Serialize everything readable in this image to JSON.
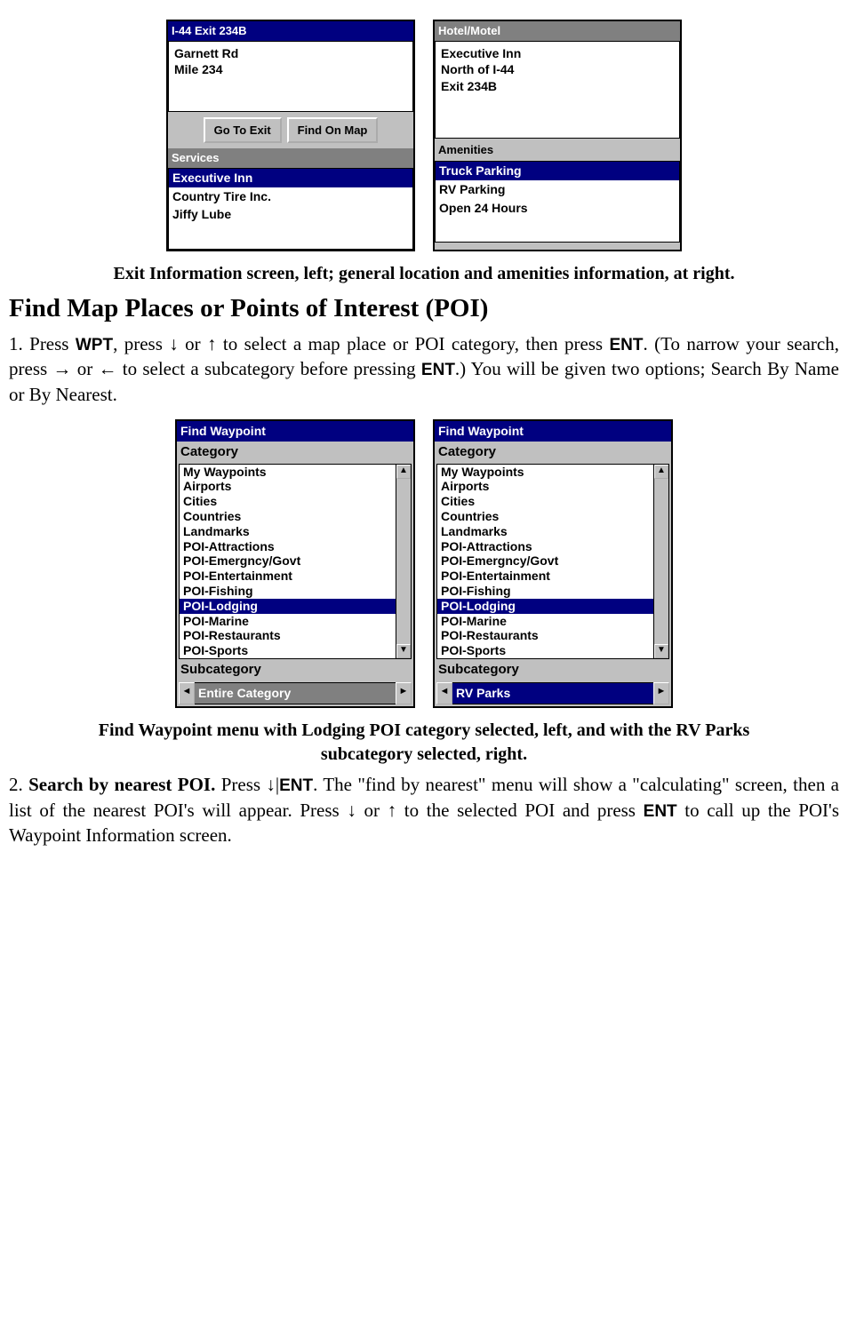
{
  "exit_screens": {
    "left": {
      "title": "I-44 Exit 234B",
      "info_lines": [
        "Garnett Rd",
        "Mile 234"
      ],
      "buttons": [
        "Go To Exit",
        "Find On Map"
      ],
      "section_label": "Services",
      "services": [
        "Executive Inn",
        "Country Tire Inc.",
        "Jiffy Lube"
      ]
    },
    "right": {
      "title": "Hotel/Motel",
      "info_lines": [
        "Executive Inn",
        "North of I-44",
        "Exit 234B"
      ],
      "section_label": "Amenities",
      "amenities": [
        "Truck Parking",
        "RV Parking",
        "Open 24 Hours"
      ]
    }
  },
  "caption1": "Exit Information screen, left; general location and amenities information, at right.",
  "heading": "Find Map Places or Points of Interest (POI)",
  "para1_parts": {
    "p1a": "1. Press ",
    "wpt": "WPT",
    "p1b": ", press ↓ or ↑ to select a map place or POI category, then press ",
    "ent1": "ENT",
    "p1c": ". (To narrow your search, press → or ← to select a subcategory before pressing ",
    "ent2": "ENT",
    "p1d": ".) You will be given two options; Search By Name or By Nearest."
  },
  "fw_panels": {
    "title": "Find Waypoint",
    "category_label": "Category",
    "items": [
      "My Waypoints",
      "Airports",
      "Cities",
      "Countries",
      "Landmarks",
      "POI-Attractions",
      "POI-Emergncy/Govt",
      "POI-Entertainment",
      "POI-Fishing",
      "POI-Lodging",
      "POI-Marine",
      "POI-Restaurants",
      "POI-Sports"
    ],
    "selected_index": 9,
    "subcategory_label": "Subcategory",
    "left_sub": "Entire Category",
    "right_sub": "RV Parks"
  },
  "caption2": "Find Waypoint menu with Lodging POI category selected, left, and with the RV Parks subcategory selected, right.",
  "para2_parts": {
    "p2a": "2. ",
    "bold": "Search by nearest POI.",
    "p2b": " Press ↓|",
    "ent": "ENT",
    "p2c": ". The \"find by nearest\" menu will show a \"calculating\" screen, then a list of the nearest POI's will appear. Press ↓ or ↑ to the selected POI and press ",
    "ent2": "ENT",
    "p2d": " to call up the POI's Waypoint Information screen."
  }
}
